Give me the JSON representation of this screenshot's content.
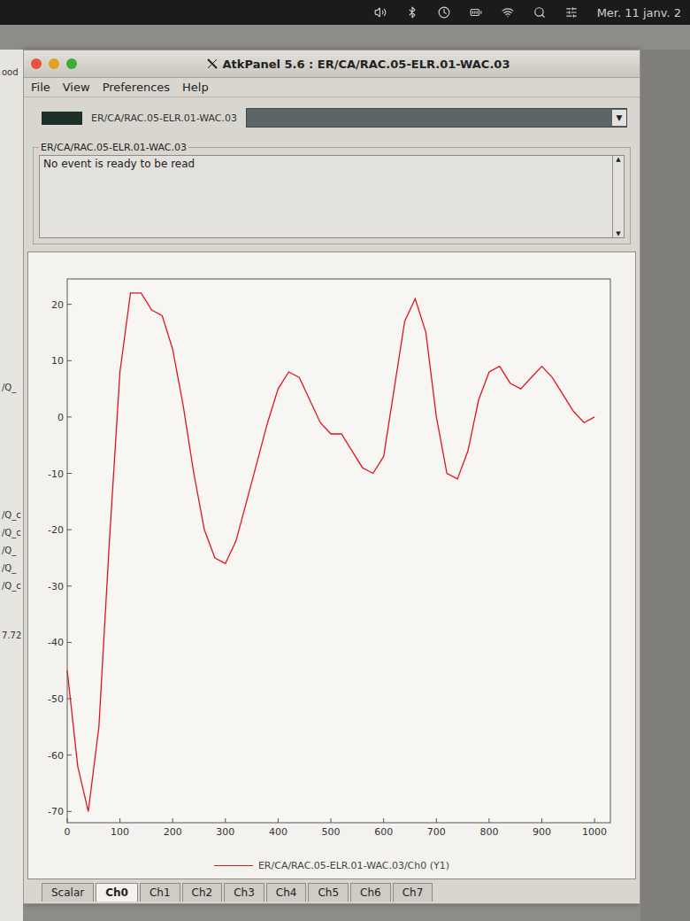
{
  "menubar": {
    "date": "Mer. 11 janv. 2"
  },
  "background_window": {
    "texts": [
      "ood",
      "/Q_",
      "/Q_c",
      "/Q_c",
      "/Q_",
      "/Q_",
      "/Q_c",
      "7.72"
    ]
  },
  "window": {
    "title": "AtkPanel 5.6 : ER/CA/RAC.05-ELR.01-WAC.03",
    "menu": [
      "File",
      "View",
      "Preferences",
      "Help"
    ]
  },
  "attribute": {
    "name": "ER/CA/RAC.05-ELR.01-WAC.03"
  },
  "events": {
    "title": "ER/CA/RAC.05-ELR.01-WAC.03",
    "message": "No event is ready to be read"
  },
  "chart": {
    "y_ticks": [
      "20",
      "10",
      "0",
      "-10",
      "-20",
      "-30",
      "-40",
      "-50",
      "-60",
      "-70"
    ],
    "x_ticks": [
      "0",
      "100",
      "200",
      "300",
      "400",
      "500",
      "600",
      "700",
      "800",
      "900",
      "1000"
    ],
    "series": [
      {
        "legend": "ER/CA/RAC.05-ELR.01-WAC.03/Ch0 (Y1)",
        "color": "#e0141e",
        "values": [
          -45,
          -62,
          -70,
          -55,
          -22,
          8,
          22,
          22,
          19,
          18,
          12,
          2,
          -10,
          -20,
          -25,
          -26,
          -22,
          -15,
          -8,
          -1,
          5,
          8,
          7,
          3,
          -1,
          -3,
          -3,
          -6,
          -9,
          -10,
          -7,
          5,
          17,
          21,
          15,
          0,
          -10,
          -11,
          -6,
          3,
          8,
          9,
          6,
          5,
          7,
          9,
          7,
          4,
          1,
          -1,
          0
        ]
      }
    ]
  },
  "tabs": [
    {
      "label": "Scalar",
      "selected": false
    },
    {
      "label": "Ch0",
      "selected": true
    },
    {
      "label": "Ch1",
      "selected": false
    },
    {
      "label": "Ch2",
      "selected": false
    },
    {
      "label": "Ch3",
      "selected": false
    },
    {
      "label": "Ch4",
      "selected": false
    },
    {
      "label": "Ch5",
      "selected": false
    },
    {
      "label": "Ch6",
      "selected": false
    },
    {
      "label": "Ch7",
      "selected": false
    }
  ]
}
